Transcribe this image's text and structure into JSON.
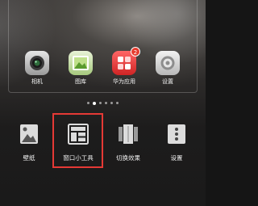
{
  "home_preview": {
    "apps": [
      {
        "icon": "camera-icon",
        "label": "相机"
      },
      {
        "icon": "gallery-icon",
        "label": "图库"
      },
      {
        "icon": "appgallery-icon",
        "label": "华为应用",
        "badge": "2"
      },
      {
        "icon": "settings-icon",
        "label": "设置"
      }
    ],
    "pages": {
      "count": 6,
      "active_index": 1
    }
  },
  "edit_menu": {
    "items": [
      {
        "icon": "wallpaper-icon",
        "label": "壁纸"
      },
      {
        "icon": "widgets-icon",
        "label": "窗口小工具"
      },
      {
        "icon": "transition-effects-icon",
        "label": "切换效果"
      },
      {
        "icon": "more-settings-icon",
        "label": "设置"
      }
    ],
    "highlighted_item": "窗口小工具",
    "highlight_color": "#e53935"
  }
}
